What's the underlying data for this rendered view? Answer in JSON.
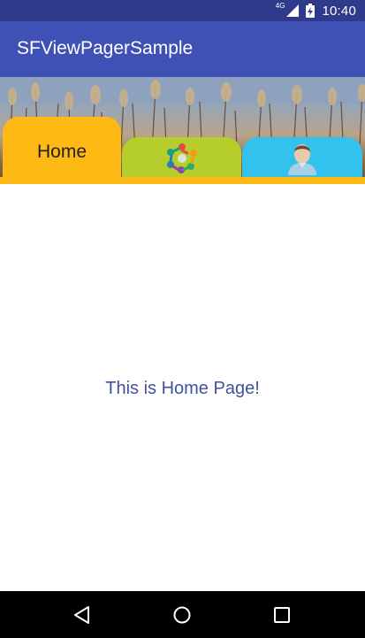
{
  "status_bar": {
    "network": "4G",
    "time": "10:40",
    "icons": [
      "signal-icon",
      "battery-icon"
    ]
  },
  "app_bar": {
    "title": "SFViewPagerSample",
    "color": "#3f51b5"
  },
  "tabs": [
    {
      "label": "Home",
      "icon": null,
      "color": "#ffb915",
      "selected": true
    },
    {
      "label": "",
      "icon": "people-circle-icon",
      "color": "#b6ce2c",
      "selected": false
    },
    {
      "label": "",
      "icon": "user-avatar-icon",
      "color": "#33c1ee",
      "selected": false
    }
  ],
  "content": {
    "text": "This is Home Page!"
  },
  "nav_bar": {
    "buttons": [
      "back-icon",
      "home-icon",
      "recent-apps-icon"
    ]
  }
}
